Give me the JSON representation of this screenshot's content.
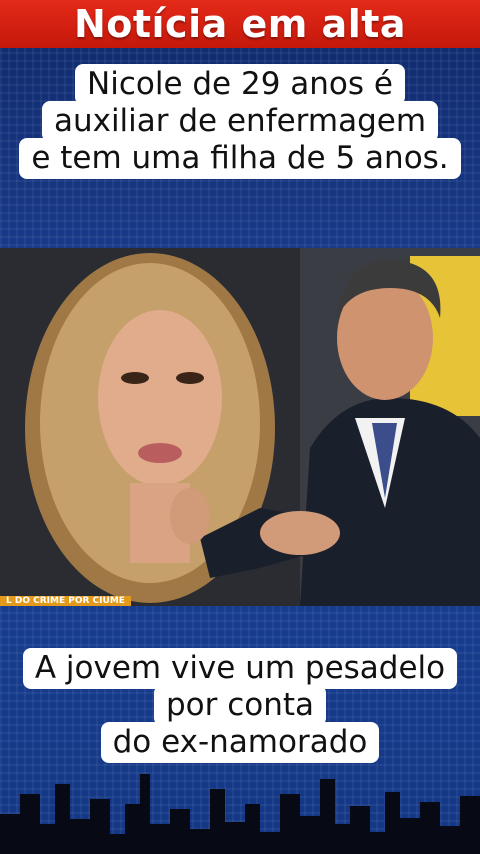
{
  "banner": {
    "title": "Notícia em alta"
  },
  "caption_top": {
    "lines": [
      "Nicole de 29 anos é",
      "auxiliar de enfermagem",
      "e tem uma filha de 5 anos."
    ]
  },
  "video": {
    "ticker": "L DO CRIME POR CIÚME",
    "scene": "news-studio-anchor-with-photo-of-woman"
  },
  "caption_bottom": {
    "lines": [
      "A jovem vive um pesadelo",
      "por conta",
      "do ex-namorado"
    ]
  },
  "colors": {
    "banner_red": "#d4200f",
    "background_blue": "#1c4298",
    "caption_bg": "#ffffff"
  }
}
